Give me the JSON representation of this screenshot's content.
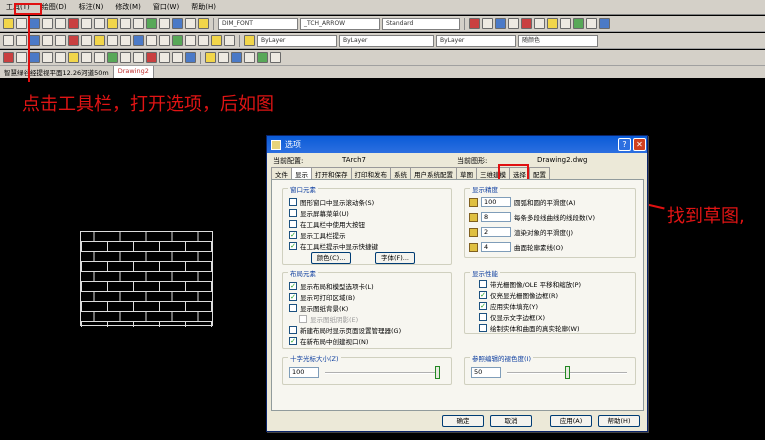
{
  "menu": [
    "工具(T)",
    "绘图(D)",
    "标注(N)",
    "修改(M)",
    "窗口(W)",
    "帮助(H)"
  ],
  "toolbar": {
    "dimstyle": "DIM_FONT",
    "textstyle": "_TCH_ARROW",
    "tablestyle": "Standard",
    "layer": "ByLayer",
    "linetype": "ByLayer",
    "lineweight": "ByLayer",
    "color": "随颜色"
  },
  "doc_tabs": [
    "智慧绿谷经提视平面12.26河道50m",
    "Drawing2"
  ],
  "annotations": {
    "step1": "点击工具栏，打开选项，后如图",
    "step2": "找到草图,"
  },
  "dialog": {
    "title": "选项",
    "current_profile_label": "当前配置:",
    "current_profile": "TArch7",
    "current_drawing_label": "当前图形:",
    "current_drawing": "Drawing2.dwg",
    "tabs": [
      "文件",
      "显示",
      "打开和保存",
      "打印和发布",
      "系统",
      "用户系统配置",
      "草图",
      "三维建模",
      "选择",
      "配置"
    ],
    "window_elements": {
      "title": "窗口元素",
      "items": [
        {
          "label": "图形窗口中显示滚动条(S)",
          "checked": false
        },
        {
          "label": "显示屏幕菜单(U)",
          "checked": false
        },
        {
          "label": "在工具栏中使用大按钮",
          "checked": false
        },
        {
          "label": "显示工具栏提示",
          "checked": true
        },
        {
          "label": "在工具栏提示中显示快捷键",
          "checked": true
        }
      ],
      "color_btn": "颜色(C)...",
      "font_btn": "字体(F)..."
    },
    "layout_elements": {
      "title": "布局元素",
      "items": [
        {
          "label": "显示布局和模型选项卡(L)",
          "checked": true
        },
        {
          "label": "显示可打印区域(B)",
          "checked": true
        },
        {
          "label": "显示图纸背景(K)",
          "checked": false
        },
        {
          "label": "显示图纸阴影(E)",
          "checked": false,
          "disabled": true
        },
        {
          "label": "新建布局时显示页面设置管理器(G)",
          "checked": false
        },
        {
          "label": "在新布局中创建视口(N)",
          "checked": true
        }
      ]
    },
    "crosshair": {
      "title": "十字光标大小(Z)",
      "value": "100",
      "fraction": 1.0
    },
    "display_resolution": {
      "title": "显示精度",
      "items": [
        {
          "value": "100",
          "label": "圆弧和圆的平滑度(A)"
        },
        {
          "value": "8",
          "label": "每条多段线曲线的线段数(V)"
        },
        {
          "value": "2",
          "label": "渲染对象的平滑度(J)"
        },
        {
          "value": "4",
          "label": "曲面轮廓素线(O)"
        }
      ]
    },
    "display_performance": {
      "title": "显示性能",
      "items": [
        {
          "label": "带光栅图像/OLE 平移和缩放(P)",
          "checked": false
        },
        {
          "label": "仅亮显光栅图像边框(R)",
          "checked": true
        },
        {
          "label": "应用实体填充(Y)",
          "checked": true
        },
        {
          "label": "仅显示文字边框(X)",
          "checked": false
        },
        {
          "label": "绘制实体和曲面的真实轮廓(W)",
          "checked": false
        }
      ]
    },
    "fade_control": {
      "title": "参照编辑的褪色度(I)",
      "value": "50",
      "fraction": 0.5
    },
    "buttons": {
      "ok": "确定",
      "cancel": "取消",
      "apply": "应用(A)",
      "help": "帮助(H)"
    }
  }
}
